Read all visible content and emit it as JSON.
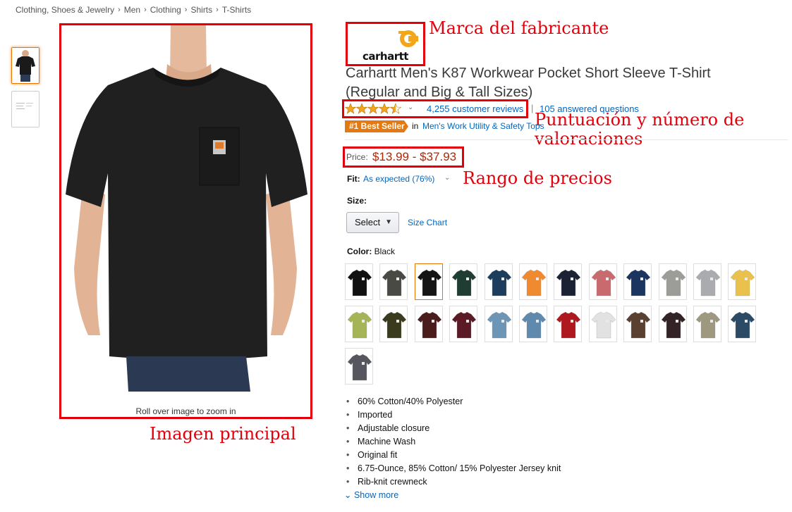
{
  "breadcrumb": [
    "Clothing, Shoes & Jewelry",
    "Men",
    "Clothing",
    "Shirts",
    "T-Shirts"
  ],
  "image": {
    "zoom_hint": "Roll over image to zoom in"
  },
  "annotations": {
    "main_image": "Imagen principal",
    "brand": "Marca del fabricante",
    "rating": "Puntuación y número de valoraciones",
    "price": "Rango de precios"
  },
  "product": {
    "brand": "carhartt",
    "title": "Carhartt Men's K87 Workwear Pocket Short Sleeve T-Shirt (Regular and Big & Tall Sizes)",
    "rating": 4.5,
    "reviews": "4,255 customer reviews",
    "answered": "105 answered questions",
    "best_seller": "#1 Best Seller",
    "best_in": "in",
    "best_category": "Men's Work Utility & Safety Tops",
    "price_label": "Price:",
    "price": "$13.99 - $37.93",
    "fit_label": "Fit:",
    "fit_value": "As expected (76%)",
    "size_label": "Size:",
    "size_select": "Select",
    "size_chart": "Size Chart",
    "color_label": "Color:",
    "color_value": "Black",
    "colors": [
      "#111111",
      "#4a4a45",
      "#151515",
      "#1f3d33",
      "#1d3d5c",
      "#ef8a30",
      "#1b2233",
      "#c96a6e",
      "#1c3560",
      "#9c9c98",
      "#a9abae",
      "#e9c14c",
      "#a6b458",
      "#3a3a1c",
      "#4a1c1c",
      "#5c1a26",
      "#6c95b6",
      "#5f89ad",
      "#b01820",
      "#e2e2e2",
      "#5a4030",
      "#332326",
      "#9e9880",
      "#2a4a66",
      "#55565e"
    ],
    "bullets": [
      "60% Cotton/40% Polyester",
      "Imported",
      "Adjustable closure",
      "Machine Wash",
      "Original fit",
      "6.75-Ounce, 85% Cotton/ 15% Polyester Jersey knit",
      "Rib-knit crewneck"
    ],
    "show_more": "Show more"
  }
}
